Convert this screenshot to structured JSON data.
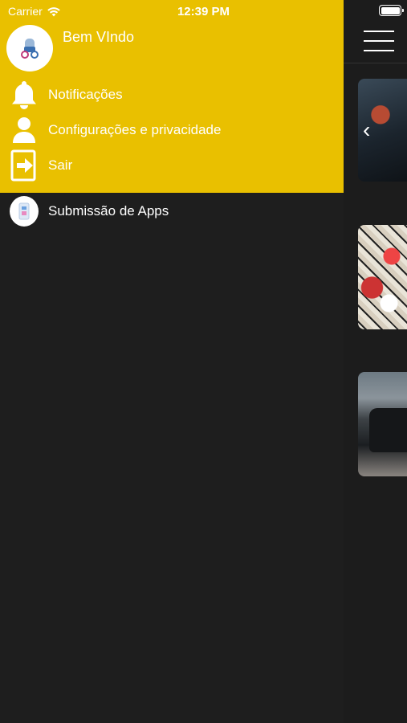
{
  "status_bar": {
    "carrier": "Carrier",
    "time": "12:39 PM",
    "battery_level": 1.0
  },
  "drawer": {
    "background_color": "#e9c000",
    "welcome_text": "Bem VIndo",
    "avatar_icon": "user-avatar-icon",
    "items": [
      {
        "label": "Notificações",
        "icon": "bell-icon"
      },
      {
        "label": "Configurações e privacidade",
        "icon": "person-icon"
      },
      {
        "label": "Sair",
        "icon": "logout-icon"
      }
    ],
    "extra_item": {
      "label": "Submissão de Apps",
      "icon": "app-submission-icon"
    }
  },
  "main": {
    "menu_icon": "hamburger-icon",
    "cards": [
      {
        "name": "featured-card-1",
        "icon": "chevron-left-icon"
      },
      {
        "name": "featured-card-2"
      },
      {
        "name": "featured-card-3"
      }
    ]
  }
}
